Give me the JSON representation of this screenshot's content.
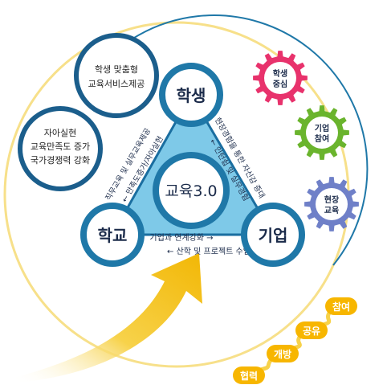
{
  "center": {
    "label": "교육3.0"
  },
  "vertices": {
    "student": "학생",
    "school": "학교",
    "company": "기업"
  },
  "info_circles": {
    "top": [
      "학생 맞춤형",
      "교육서비스제공"
    ],
    "left": [
      "자아실현",
      "교육만족도 증가",
      "국가경쟁력 강화"
    ]
  },
  "edges": {
    "left_outer": "직무교육 및 실무교육제공",
    "left_inner": "← 만족도증가/자아실현",
    "right_outer": "현장경험을 통한 자신감 증대",
    "right_inner": "← 인턴쉽 및 실무경험",
    "bottom_top": "기업과 연계강화 →",
    "bottom_bottom": "← 산학 및 프로젝트 수업"
  },
  "gears": [
    {
      "lines": [
        "학생",
        "중심"
      ],
      "color": "#e8326c"
    },
    {
      "lines": [
        "기업",
        "참여"
      ],
      "color": "#6ab42d"
    },
    {
      "lines": [
        "현장",
        "교육"
      ],
      "color": "#6f80c8"
    }
  ],
  "steps": [
    "협력",
    "개방",
    "공유",
    "참여"
  ],
  "colors": {
    "ring": "#1f78a8",
    "triangle": "#7ec9e8",
    "triangle_stroke": "#1a6ea0",
    "arrow": "#f2b705",
    "step": "#f7b600"
  }
}
